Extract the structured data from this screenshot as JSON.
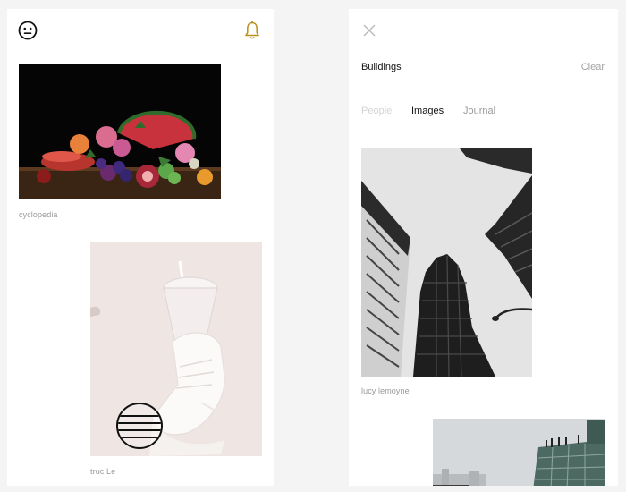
{
  "left_screen": {
    "header": {
      "avatar_icon": "smiley-face-icon",
      "notifications_icon": "bell-icon",
      "accent_color": "#b8901c"
    },
    "feed": [
      {
        "caption": "cyclopedia",
        "image": "still-life-fruit-flowers-photo"
      },
      {
        "caption": "truc Le",
        "image": "sneaker-and-plastic-cup-photo"
      }
    ],
    "menu_icon": "hamburger-circle-icon"
  },
  "right_screen": {
    "close_icon": "close-icon",
    "search": {
      "query": "Buildings",
      "clear_label": "Clear"
    },
    "tabs": [
      {
        "label": "People",
        "state": "disabled"
      },
      {
        "label": "Images",
        "state": "active"
      },
      {
        "label": "Journal",
        "state": "inactive"
      }
    ],
    "results": [
      {
        "caption": "lucy lemoyne",
        "image": "black-and-white-skyscrapers-photo"
      },
      {
        "caption": "",
        "image": "glass-building-with-people-photo"
      }
    ]
  }
}
